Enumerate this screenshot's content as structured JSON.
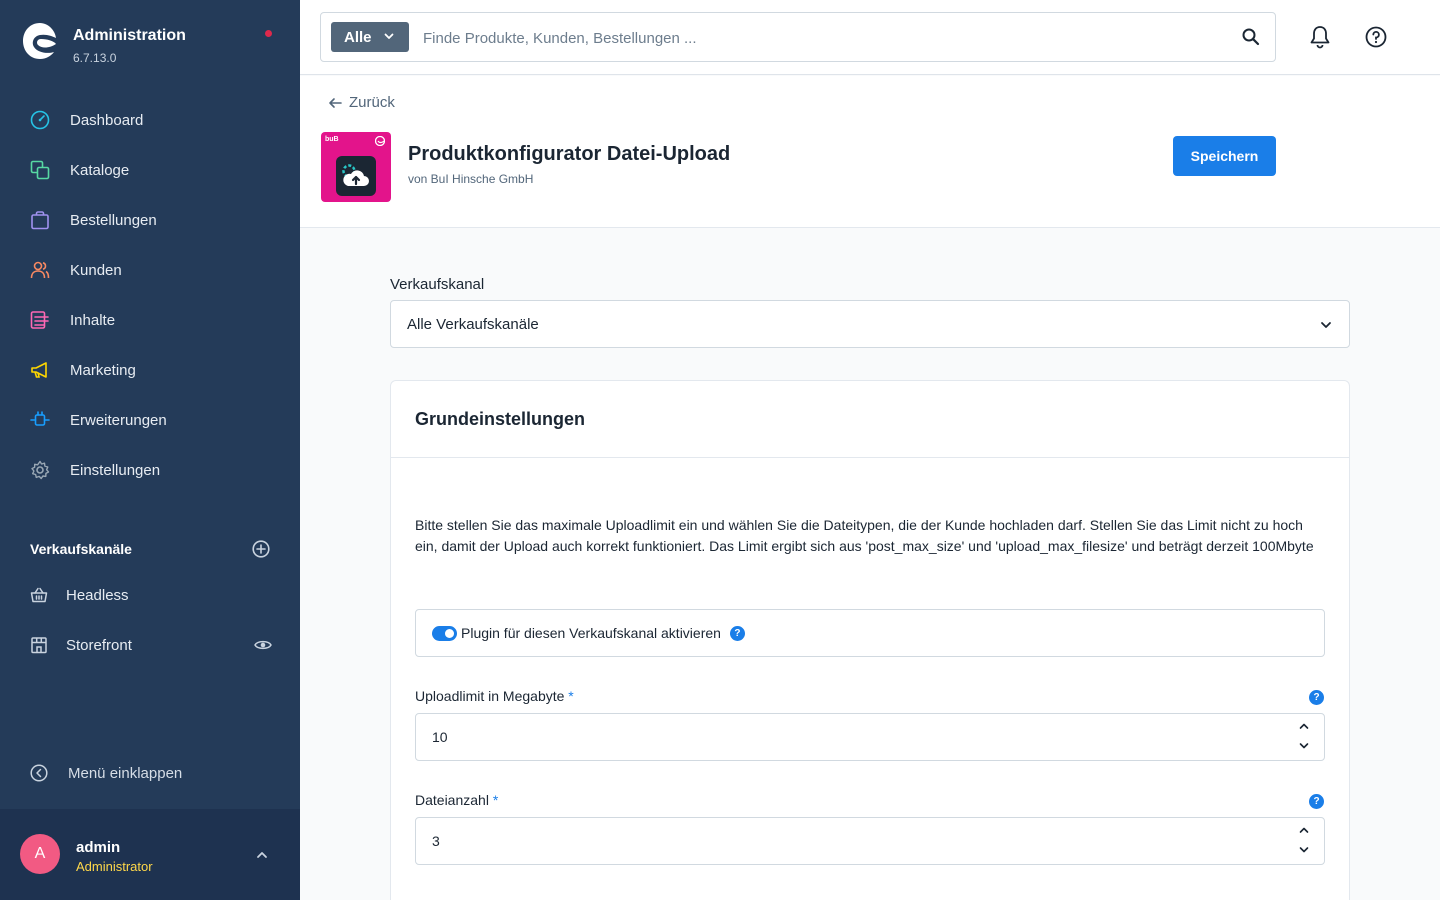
{
  "sidebar": {
    "title": "Administration",
    "version": "6.7.13.0",
    "nav": [
      {
        "label": "Dashboard",
        "icon": "dashboard-icon",
        "color": "#26c3e6"
      },
      {
        "label": "Kataloge",
        "icon": "catalog-icon",
        "color": "#57d9a3"
      },
      {
        "label": "Bestellungen",
        "icon": "shopping-bag-icon",
        "color": "#a092f0"
      },
      {
        "label": "Kunden",
        "icon": "customers-icon",
        "color": "#f88962"
      },
      {
        "label": "Inhalte",
        "icon": "content-icon",
        "color": "#ff68b4"
      },
      {
        "label": "Marketing",
        "icon": "megaphone-icon",
        "color": "#ffd700"
      },
      {
        "label": "Erweiterungen",
        "icon": "plug-icon",
        "color": "#189eff"
      },
      {
        "label": "Einstellungen",
        "icon": "gear-icon",
        "color": "#9aa8b5"
      }
    ],
    "sales_channels_title": "Verkaufskanäle",
    "sales_channels": [
      {
        "label": "Headless",
        "icon": "basket-icon"
      },
      {
        "label": "Storefront",
        "icon": "storefront-icon"
      }
    ],
    "collapse_label": "Menü einklappen",
    "user": {
      "initial": "A",
      "name": "admin",
      "role": "Administrator"
    }
  },
  "topbar": {
    "search_type": "Alle",
    "search_placeholder": "Finde Produkte, Kunden, Bestellungen ..."
  },
  "page": {
    "back_label": "Zurück",
    "plugin_title": "Produktkonfigurator Datei-Upload",
    "plugin_vendor": "von BuI Hinsche GmbH",
    "app_icon_brand": "buB",
    "save_label": "Speichern"
  },
  "content": {
    "sales_channel_label": "Verkaufskanal",
    "sales_channel_value": "Alle Verkaufskanäle",
    "card_title": "Grundeinstellungen",
    "description": "Bitte stellen Sie das maximale Uploadlimit ein und wählen Sie die Dateitypen, die der Kunde hochladen darf. Stellen Sie das Limit nicht zu hoch ein, damit der Upload auch korrekt funktioniert. Das Limit ergibt sich aus 'post_max_size' und 'upload_max_filesize' und beträgt derzeit 100Mbyte",
    "toggle_label": "Plugin für diesen Verkaufskanal aktivieren",
    "toggle_on": true,
    "fields": [
      {
        "label": "Uploadlimit in Megabyte",
        "required_mark": "*",
        "value": "10"
      },
      {
        "label": "Dateianzahl",
        "required_mark": "*",
        "value": "3"
      }
    ],
    "help_mark": "?"
  },
  "colors": {
    "sidebar_bg": "#243b59",
    "accent": "#1a7ee8",
    "avatar": "#f25a83",
    "role": "#ffd84a",
    "plugin_icon_bg": "#e3148b"
  }
}
